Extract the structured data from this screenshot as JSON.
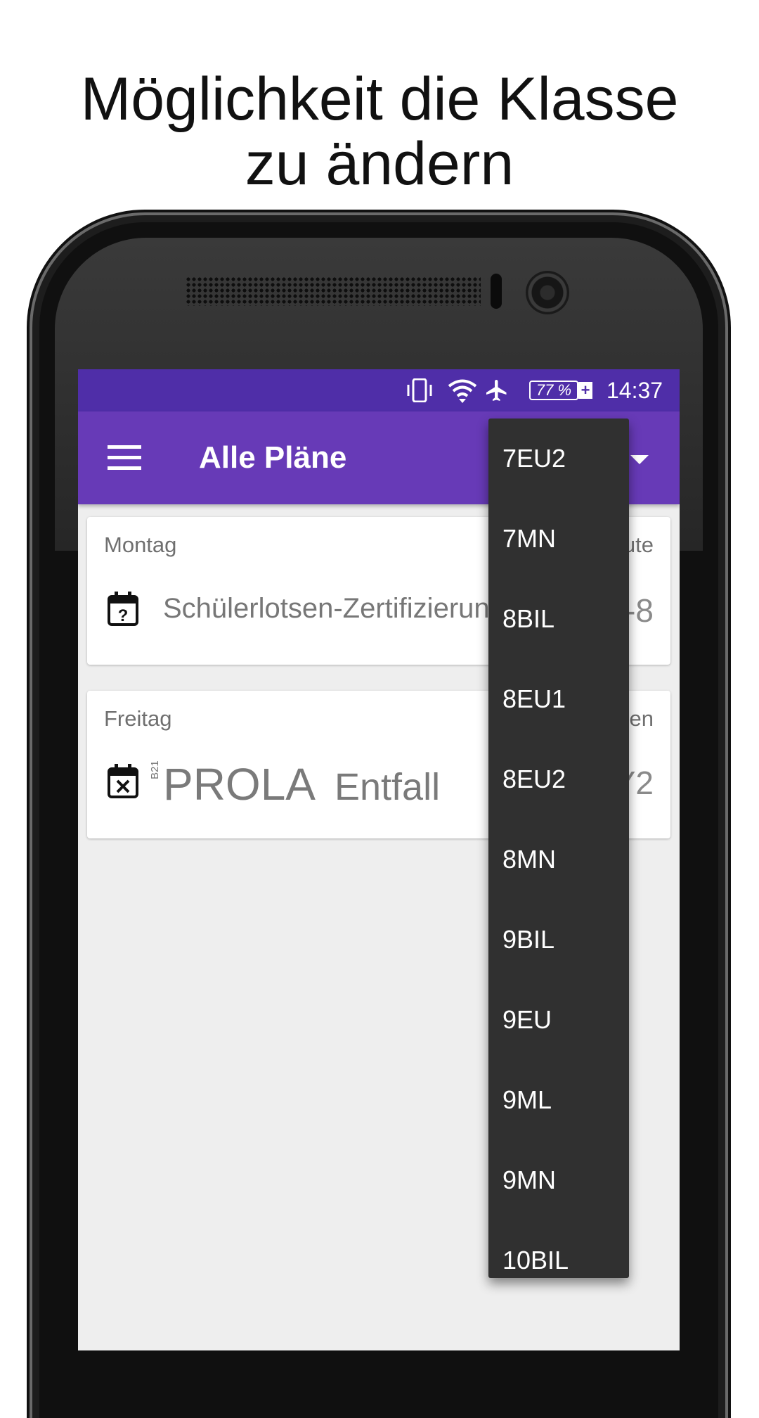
{
  "caption": {
    "line1": "Möglichkeit die Klasse",
    "line2": "zu ändern"
  },
  "statusbar": {
    "battery": "77 %",
    "time": "14:37",
    "icons": [
      "vibrate-icon",
      "wifi-icon",
      "airplane-icon",
      "battery-charging-icon"
    ]
  },
  "appbar": {
    "title": "Alle Pläne"
  },
  "cards": [
    {
      "day": "Montag",
      "right_top": "ute",
      "text": "Schülerlotsen-Zertifizierung",
      "right_big": "-8",
      "icon": "calendar-question-icon"
    },
    {
      "day": "Freitag",
      "right_top": "en",
      "room": "B21",
      "subject": "PROLA",
      "status": "Entfall",
      "right_big": "Y2",
      "icon": "calendar-cancel-icon"
    }
  ],
  "dropdown": {
    "items": [
      "7EU2",
      "7MN",
      "8BIL",
      "8EU1",
      "8EU2",
      "8MN",
      "9BIL",
      "9EU",
      "9ML",
      "9MN",
      "10BIL"
    ]
  },
  "colors": {
    "statusbar": "#4f2ea8",
    "appbar": "#673ab7",
    "dropdown": "#303030",
    "screen_bg": "#eeeeee"
  }
}
